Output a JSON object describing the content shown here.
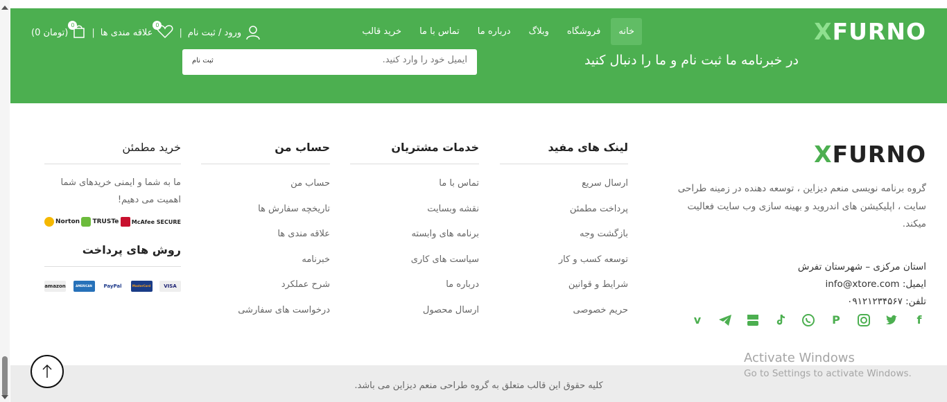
{
  "header": {
    "logo_x": "X",
    "logo_rest": "FURNO",
    "nav": [
      "خانه",
      "فروشگاه",
      "وبلاگ",
      "درباره ما",
      "تماس با ما",
      "خرید قالب"
    ],
    "login_label": "ورود / ثبت نام",
    "wishlist_label": "علاقه مندی ها",
    "wishlist_count": "0",
    "cart_count": "0",
    "cart_total": "(0 تومان)",
    "separator": "|"
  },
  "newsletter": {
    "title": "در خبرنامه ما ثبت نام و ما را دنبال کنید",
    "placeholder": "ایمیل خود را وارد کنید.",
    "submit_label": "ثبت نام"
  },
  "about": {
    "logo_x": "X",
    "logo_rest": "FURNO",
    "description": "گروه برنامه نویسی منعم دیزاین ، توسعه دهنده در زمینه طراحی سایت ، اپلیکیشن های اندروید و بهینه سازی وب سایت فعالیت میکند.",
    "address": "استان مرکزی – شهرستان تفرش",
    "email": "ایمیل: info@xtore.com",
    "phone": "تلفن: ۰۹۱۲۱۲۳۴۵۶۷"
  },
  "social_icons": [
    "facebook-icon",
    "twitter-icon",
    "instagram-icon",
    "pinterest-icon",
    "whatsapp-icon",
    "tiktok-icon",
    "youtube-icon",
    "telegram-icon",
    "vimeo-icon"
  ],
  "useful_links": {
    "title": "لینک های مفید",
    "items": [
      "ارسال سریع",
      "پرداخت مطمئن",
      "بازگشت وجه",
      "توسعه کسب و کار",
      "شرایط و قوانین",
      "حریم خصوصی"
    ]
  },
  "customer_services": {
    "title": "خدمات مشتریان",
    "items": [
      "تماس با ما",
      "نقشه وبسایت",
      "برنامه های وابسته",
      "سیاست های کاری",
      "درباره ما",
      "ارسال محصول"
    ]
  },
  "my_account": {
    "title": "حساب من",
    "items": [
      "حساب من",
      "تاریخچه سفارش ها",
      "علاقه مندی ها",
      "خبرنامه",
      "شرح عملکرد",
      "درخواست های سفارشی"
    ]
  },
  "secure_shopping": {
    "title": "خرید مطمئن",
    "text": "ما به شما و ایمنی خریدهای شما اهمیت می دهیم!",
    "seals": [
      "Norton",
      "TRUSTe",
      "McAfee SECURE"
    ],
    "payment_title": "روش های پرداخت",
    "cards": [
      "amazon",
      "AMERICAN EXPRESS",
      "PayPal",
      "MasterCard",
      "VISA"
    ]
  },
  "copyright": "کلیه حقوق این قالب متعلق به گروه طراحی منعم دیزاین می باشد.",
  "watermark": {
    "line1": "Activate Windows",
    "line2": "Go to Settings to activate Windows."
  },
  "colors": {
    "brand_green": "#4caf50",
    "logo_x_light": "#8fe08f"
  }
}
